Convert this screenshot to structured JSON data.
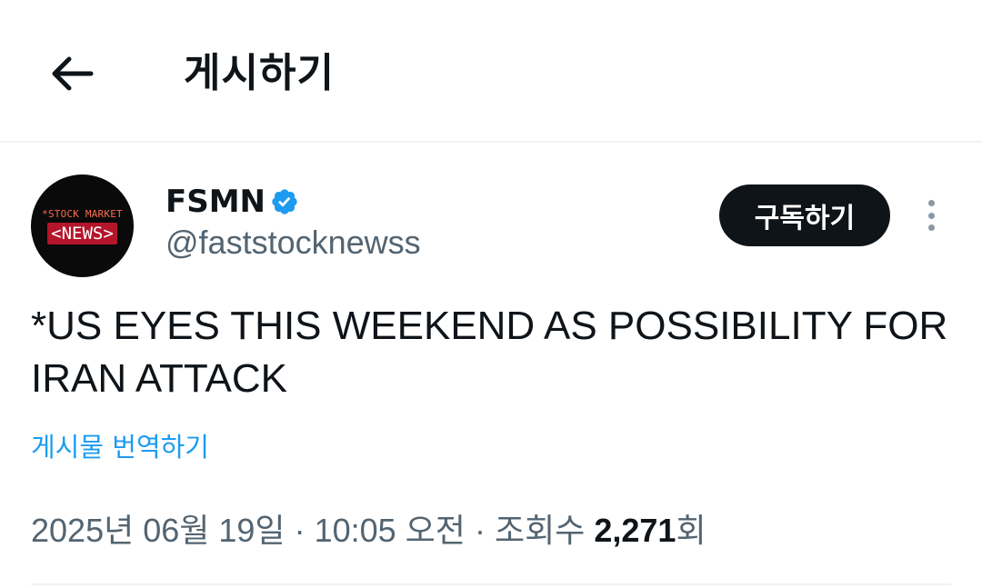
{
  "header": {
    "back_icon": "arrow-left-icon",
    "title": "게시하기"
  },
  "author": {
    "avatar": {
      "top_text": "*STOCK MARKET",
      "main_text": "<NEWS>",
      "bg_color": "#0a0a0a",
      "accent_color": "#b3152b"
    },
    "name": "FSMN",
    "verified_icon": "verified-badge-icon",
    "handle": "@faststocknewss",
    "subscribe_label": "구독하기",
    "more_icon": "more-vertical-icon"
  },
  "post": {
    "text": "*US EYES THIS WEEKEND AS POSSIBILITY FOR IRAN ATTACK",
    "translate_label": "게시물 번역하기"
  },
  "meta": {
    "date": "2025년 06월 19일",
    "separator": "·",
    "time": "10:05 오전",
    "views_label": "조회수",
    "views_count": "2,271",
    "views_suffix": "회"
  },
  "colors": {
    "link": "#1d9bf0",
    "secondary_text": "#536471",
    "primary_text": "#0f1419",
    "divider": "#eff3f4"
  }
}
